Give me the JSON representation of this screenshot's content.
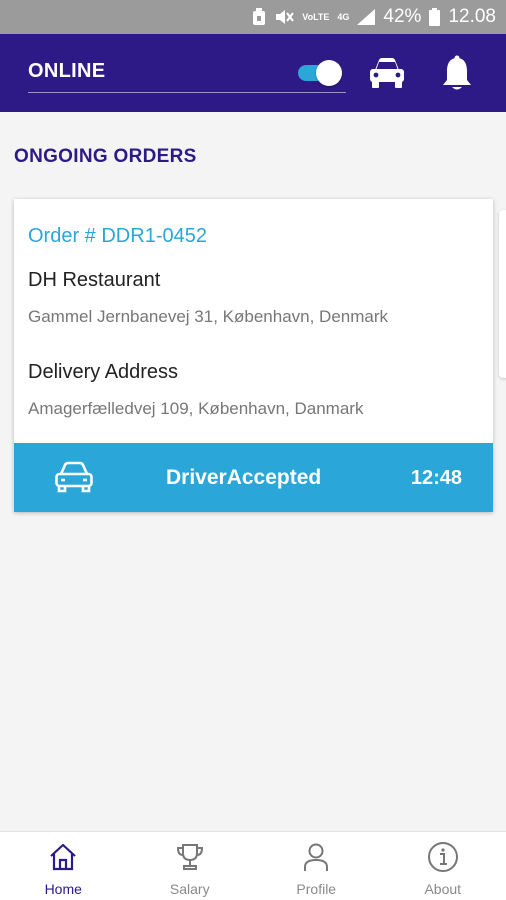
{
  "status_bar": {
    "volte": "VoLTE",
    "network": "4G",
    "battery_percent": "42%",
    "time": "12.08"
  },
  "header": {
    "status_label": "ONLINE",
    "online_toggle_on": true,
    "icons": [
      "car-icon",
      "bell-icon"
    ]
  },
  "section": {
    "title": "ONGOING ORDERS"
  },
  "order": {
    "number": "Order # DDR1-0452",
    "restaurant_name": "DH Restaurant",
    "restaurant_address": "Gammel Jernbanevej 31, København, Denmark",
    "delivery_label": "Delivery Address",
    "delivery_address": "Amagerfælledvej 109, København, Danmark",
    "status": "DriverAccepted",
    "time": "12:48"
  },
  "nav": {
    "items": [
      {
        "label": "Home",
        "icon": "home-icon",
        "active": true
      },
      {
        "label": "Salary",
        "icon": "trophy-icon",
        "active": false
      },
      {
        "label": "Profile",
        "icon": "person-icon",
        "active": false
      },
      {
        "label": "About",
        "icon": "info-icon",
        "active": false
      }
    ]
  },
  "colors": {
    "header_bg": "#2e1a86",
    "accent": "#2aa7d8",
    "page_bg": "#f4f4f4"
  }
}
